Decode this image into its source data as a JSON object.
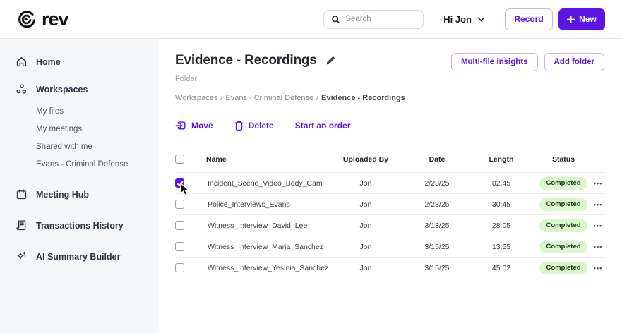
{
  "topbar": {
    "logo_text": "rev",
    "search_placeholder": "Search",
    "user_menu_label": "Hi Jon",
    "record_label": "Record",
    "new_label": "New"
  },
  "sidebar": {
    "home": "Home",
    "workspaces": "Workspaces",
    "workspace_children": {
      "my_files": "My files",
      "my_meetings": "My meetings",
      "shared_with_me": "Shared with me",
      "evans": "Evans - Criminal Defense"
    },
    "meeting_hub": "Meeting Hub",
    "transactions_history": "Transactions History",
    "ai_summary_builder": "AI Summary Builder"
  },
  "main": {
    "title": "Evidence - Recordings",
    "subtitle": "Folder",
    "breadcrumb": {
      "part1": "Workspaces",
      "part2": "Evans - Criminal Defense",
      "current": "Evidence - Recordings",
      "separator": "/"
    },
    "actions": {
      "multi_file_insights": "Multi-file insights",
      "add_folder": "Add folder"
    },
    "toolbar": {
      "move": "Move",
      "delete": "Delete",
      "start_order": "Start an order"
    },
    "table": {
      "columns": [
        "Name",
        "Uploaded By",
        "Date",
        "Length",
        "Status"
      ],
      "rows": [
        {
          "name": "Incident_Scene_Video_Body_Cam",
          "uploaded_by": "Jon",
          "date": "2/23/25",
          "length": "02:45",
          "status": "Completed",
          "checked": true
        },
        {
          "name": "Police_Interviews_Evans",
          "uploaded_by": "Jon",
          "date": "2/23/25",
          "length": "30:45",
          "status": "Completed",
          "checked": false
        },
        {
          "name": "Witness_Interview_David_Lee",
          "uploaded_by": "Jon",
          "date": "3/13/25",
          "length": "28:05",
          "status": "Completed",
          "checked": false
        },
        {
          "name": "Witness_Interview_Maria_Sanchez",
          "uploaded_by": "Jon",
          "date": "3/15/25",
          "length": "13:55",
          "status": "Completed",
          "checked": false
        },
        {
          "name": "Witness_Interview_Yesinia_Sanchez",
          "uploaded_by": "Jon",
          "date": "3/15/25",
          "length": "45:02",
          "status": "Completed",
          "checked": false
        }
      ]
    }
  },
  "ui": {
    "ellipsis": "•••",
    "plus": "+"
  },
  "colors": {
    "accent": "#5b16e3",
    "accent_soft_border": "#c9b2f8",
    "badge_bg": "#d9f6cd",
    "badge_text": "#203a20",
    "sidebar_bg": "#f6f7f9",
    "border": "#e7e8ea",
    "text_dark": "#22272e",
    "text_gray": "#8b9097"
  }
}
